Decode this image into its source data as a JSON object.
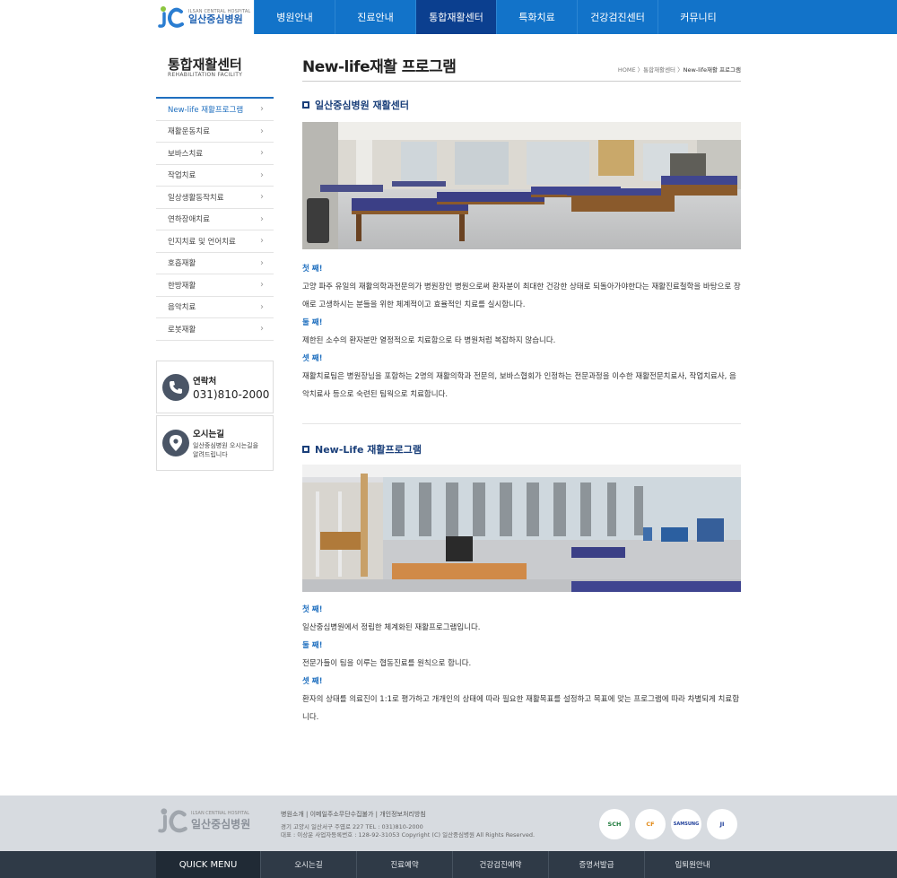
{
  "logo": {
    "en": "ILSAN CENTRAL HOSPITAL",
    "ko": "일산중심병원"
  },
  "nav": {
    "items": [
      "병원안내",
      "진료안내",
      "통합재활센터",
      "특화치료",
      "건강검진센터",
      "커뮤니티"
    ],
    "active": "통합재활센터"
  },
  "sidebar": {
    "title": "통합재활센터",
    "subtitle": "REHABILITATION FACILITY",
    "items": [
      {
        "label": "New-life 재활프로그램"
      },
      {
        "label": "재활운동치료"
      },
      {
        "label": "보바스치료"
      },
      {
        "label": "작업치료"
      },
      {
        "label": "일상생활동작치료"
      },
      {
        "label": "연하장애치료"
      },
      {
        "label": "인지치료 및 언어치료"
      },
      {
        "label": "호흡재활"
      },
      {
        "label": "한방재활"
      },
      {
        "label": "음악치료"
      },
      {
        "label": "로봇재활"
      }
    ],
    "contact": {
      "label": "연락처",
      "phone": "031)810-2000"
    },
    "directions": {
      "label": "오시는길",
      "desc_line1": "일산중심병원 오시는길을",
      "desc_line2": "알려드립니다"
    }
  },
  "page": {
    "title": "New-life재활 프로그램",
    "breadcrumb": {
      "home": "HOME",
      "sep1": " 〉",
      "section": "통합재활센터",
      "sep2": " 〉",
      "current": "New-life재활 프로그램"
    }
  },
  "section1": {
    "heading": "일산중심병원 재활센터",
    "items": [
      {
        "ordinal": "첫 째!",
        "text": "고양 파주 유일의 재활의학과전문의가 병원장인 병원으로써 환자분이 최대한 건강한 상태로 되돌아가야한다는 재활진료철학을 바탕으로 장애로 고생하시는 분들을 위한 체계적이고 효율적인 치료를 실시합니다."
      },
      {
        "ordinal": "둘 째!",
        "text": "제한된 소수의 환자분만 열정적으로 치료함으로 타 병원처럼 복잡하지 않습니다."
      },
      {
        "ordinal": "셋 째!",
        "text": "재활치료팀은 병원장님을 포함하는 2명의 재활의학과 전문의, 보바스협회가 인정하는 전문과정을 이수한 재활전문치료사, 작업치료사, 음악치료사 등으로 숙련된 팀웍으로 치료합니다."
      }
    ]
  },
  "section2": {
    "heading": "New-Life 재활프로그램",
    "items": [
      {
        "ordinal": "첫 째!",
        "text": "일산중심병원에서 정립한 체계화된 재활프로그램입니다."
      },
      {
        "ordinal": "둘 째!",
        "text": "전문가들이 팀을 이루는 협동진료를 원칙으로 합니다."
      },
      {
        "ordinal": "셋 째!",
        "text": "환자의 상태를 의료진이 1:1로 평가하고 개개인의 상태에 따라 필요한 재활목표를 설정하고 목표에 맞는 프로그램에 따라 차별되게 치료합니다."
      }
    ]
  },
  "footer": {
    "links": "병원소개   |   이메일주소무단수집불가   |   개인정보처리방침",
    "address": "경기 고양시 일산서구 주엽로 227  TEL : 031)810-2000",
    "company": "대표 : 이상운  사업자등록번호 : 128-92-31053 Copyright (C) 일산중심병원 All Rights Reserved.",
    "badges": [
      "SCH",
      "CF",
      "SAMSUNG",
      "JI"
    ]
  },
  "quick_menu": {
    "title": "QUICK MENU",
    "items": [
      "오시는길",
      "진료예약",
      "건강검진예약",
      "증명서발급",
      "입퇴원안내"
    ]
  }
}
